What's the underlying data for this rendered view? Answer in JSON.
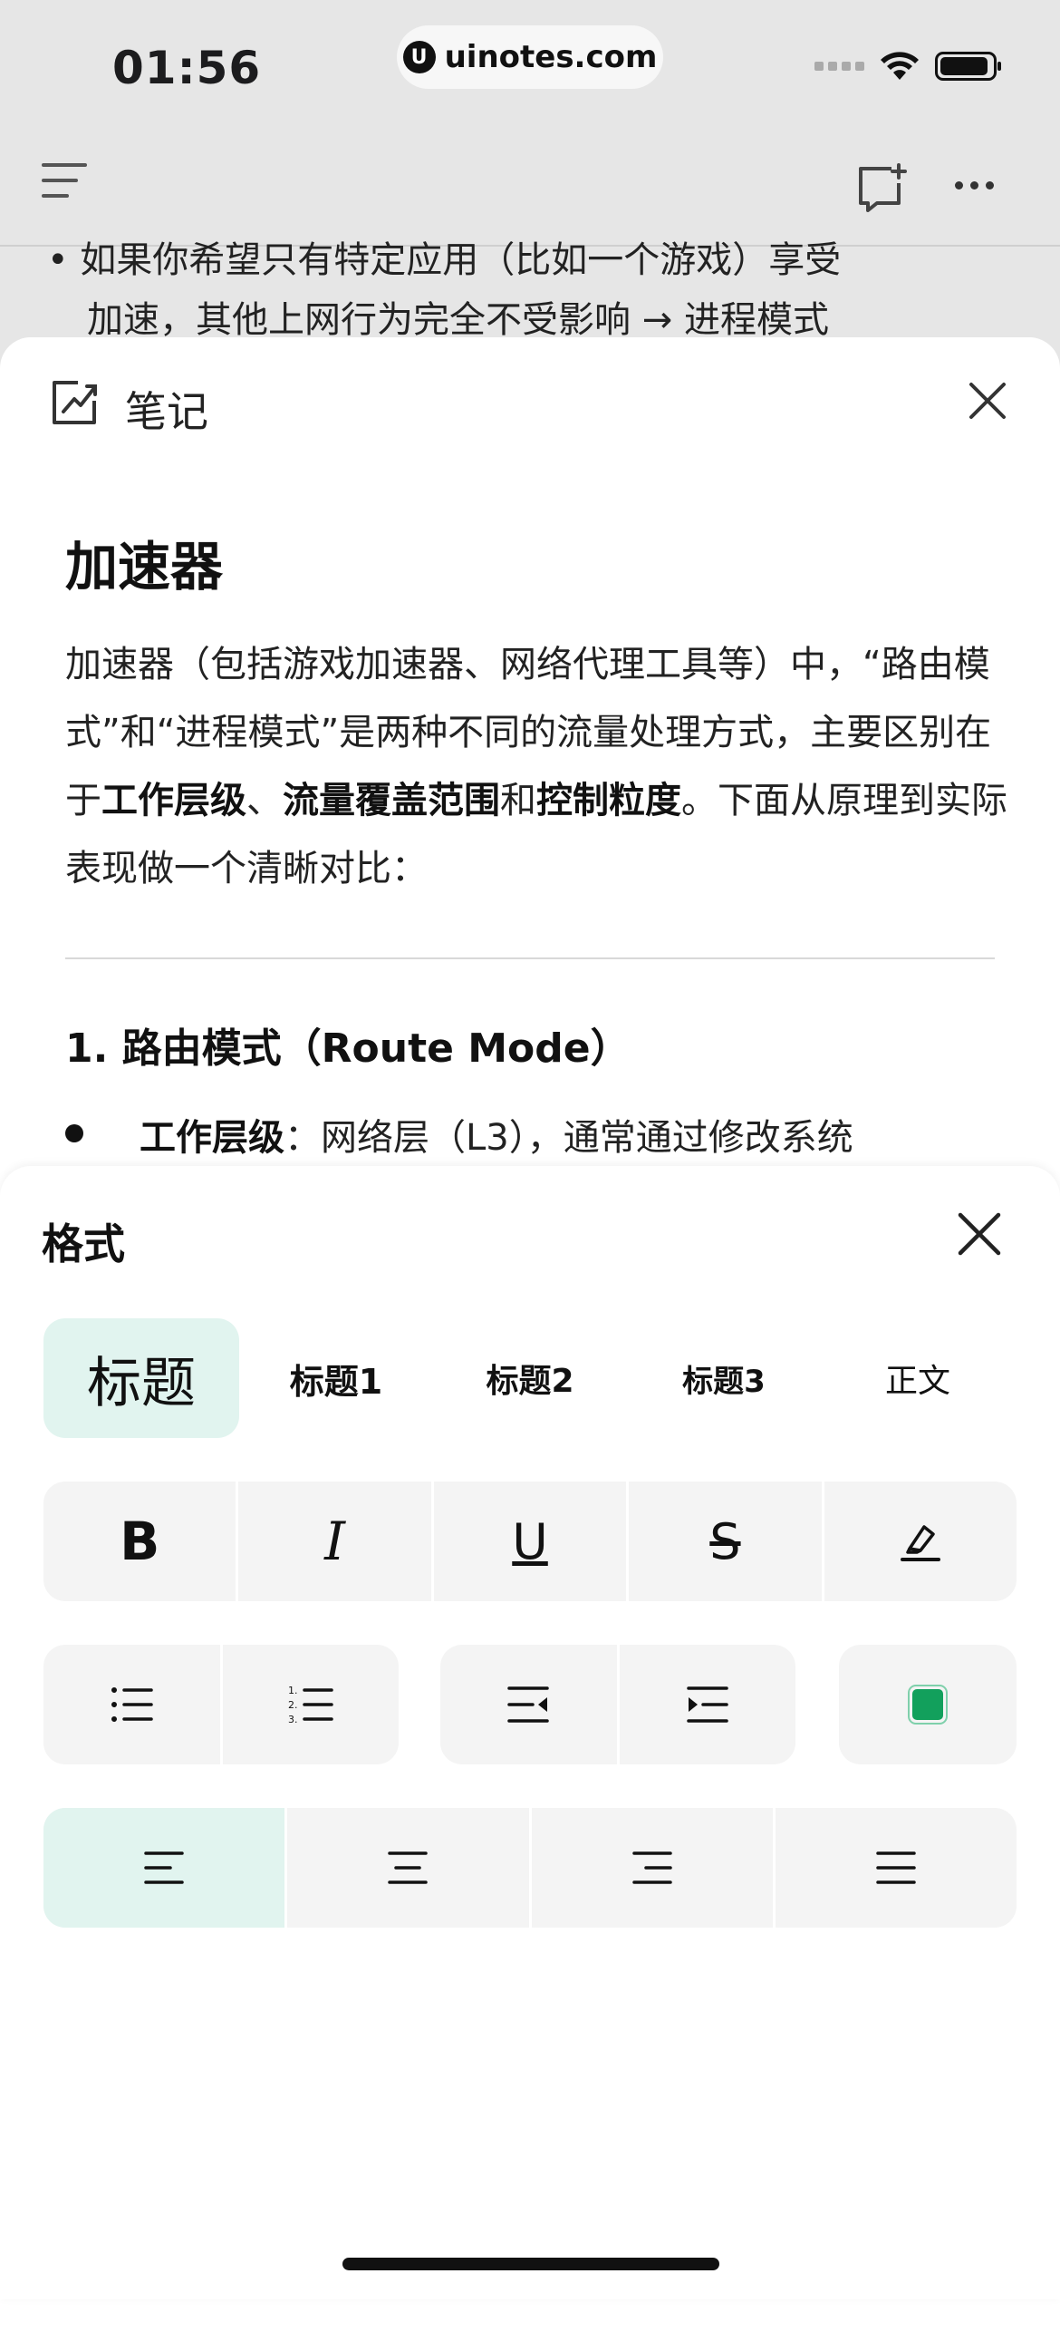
{
  "status_bar": {
    "time": "01:56",
    "url": "uinotes.com",
    "url_logo": "U"
  },
  "nav": {
    "menu_icon": "menu-icon",
    "new_note_icon": "new-note-icon",
    "more_icon": "more-icon"
  },
  "background_text": {
    "line1": "• 如果你希望只有特定应用（比如一个游戏）享受",
    "line2": "加速，其他上网行为完全不受影响 → 进程模式"
  },
  "note": {
    "header_title": "笔记",
    "heading": "加速器",
    "paragraph": {
      "p1": "加速器（包括游戏加速器、网络代理工具等）中，“路由模式”和“进程模式”是两种不同的流量处理方式，主要区别在于",
      "b1": "工作层级",
      "sep1": "、",
      "b2": "流量覆盖范围",
      "sep2": "和",
      "b3": "控制粒度",
      "p2": "。下面从原理到实际表现做一个清晰对比："
    },
    "section_title": "1. 路由模式（Route Mode）",
    "bullet": {
      "label": "工作层级",
      "text": "：网络层（L3），通常通过修改系统"
    }
  },
  "format_panel": {
    "title": "格式",
    "headings": [
      "标题",
      "标题1",
      "标题2",
      "标题3",
      "正文"
    ],
    "active_heading_index": 0,
    "styles": {
      "bold": "B",
      "italic": "I",
      "underline": "U",
      "strike": "S"
    },
    "highlight_color": "#12a05c",
    "accent_bg": "#e1f4ef",
    "active_alignment": "left"
  }
}
